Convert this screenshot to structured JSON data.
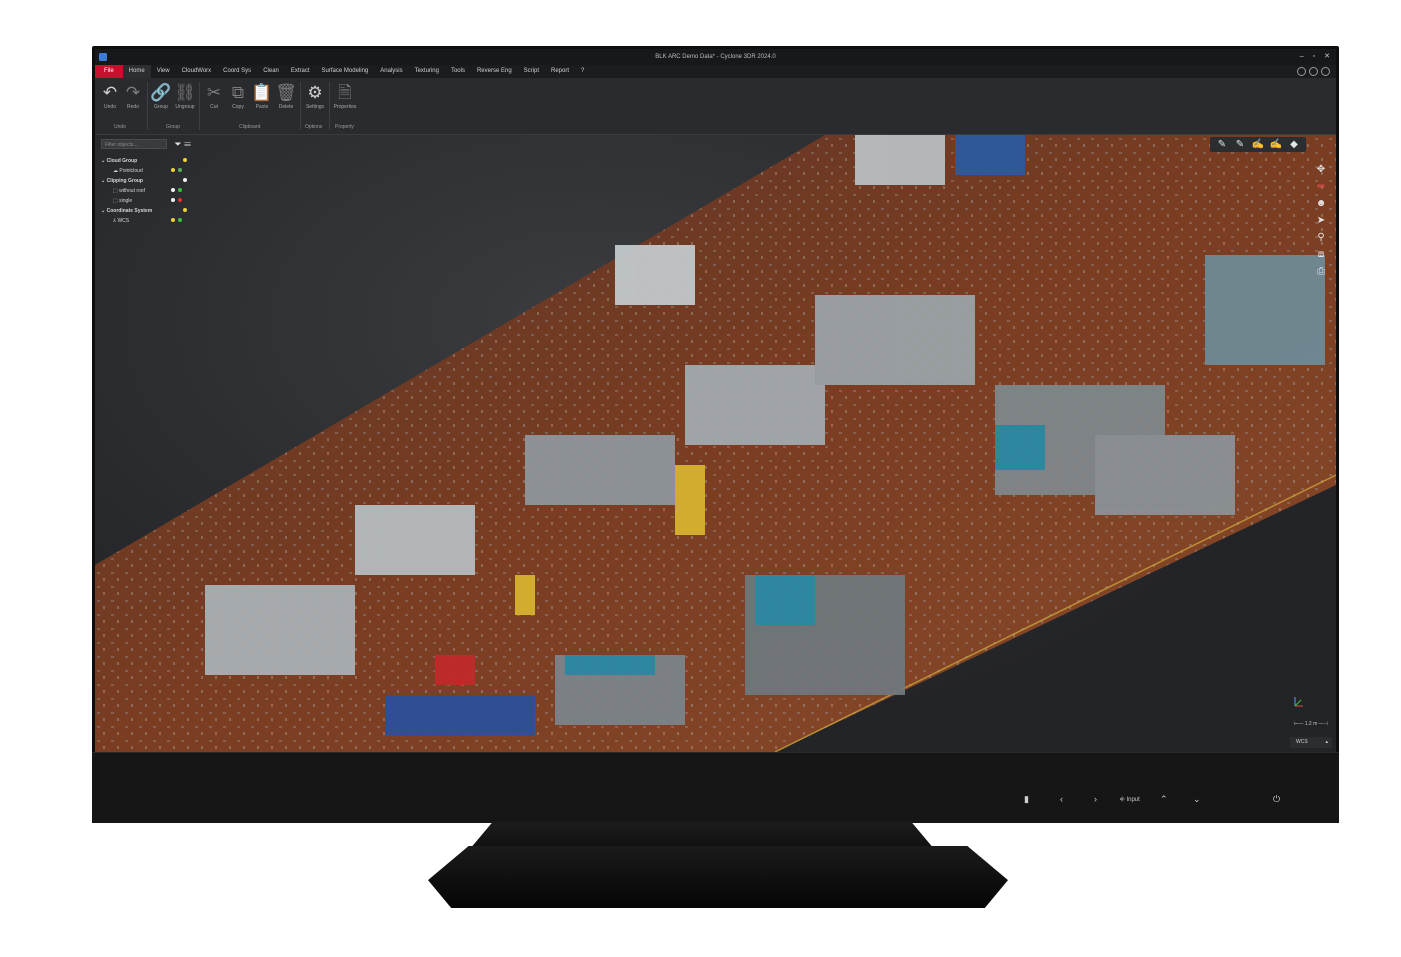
{
  "window": {
    "title": "BLK ARC Demo Data* - Cyclone 3DR 2024.0"
  },
  "menu": [
    "File",
    "Home",
    "View",
    "CloudWorx",
    "Coord Sys",
    "Clean",
    "Extract",
    "Surface Modeling",
    "Analysis",
    "Texturing",
    "Tools",
    "Reverse Eng",
    "Script",
    "Report",
    "?"
  ],
  "ribbon": {
    "buttons": [
      {
        "label": "Undo",
        "icon": "undo-icon",
        "glyph": "↶"
      },
      {
        "label": "Redo",
        "icon": "redo-icon",
        "glyph": "↷"
      },
      {
        "label": "Group",
        "icon": "link-icon",
        "glyph": "🔗"
      },
      {
        "label": "Ungroup",
        "icon": "unlink-icon",
        "glyph": "⛓"
      },
      {
        "label": "Cut",
        "icon": "scissors-icon",
        "glyph": "✂"
      },
      {
        "label": "Copy",
        "icon": "copy-icon",
        "glyph": "⧉"
      },
      {
        "label": "Paste",
        "icon": "paste-icon",
        "glyph": "📋"
      },
      {
        "label": "Delete",
        "icon": "trash-icon",
        "glyph": "🗑"
      },
      {
        "label": "Settings",
        "icon": "gears-icon",
        "glyph": "⚙"
      },
      {
        "label": "Properties",
        "icon": "document-icon",
        "glyph": "🗎"
      }
    ],
    "groups": [
      "Undo",
      "Group",
      "Clipboard",
      "Options",
      "Property"
    ]
  },
  "tree": {
    "filter_placeholder": "Filter objects...",
    "rows": [
      {
        "label": "Cloud Group",
        "bold": true
      },
      {
        "label": "Pointcloud",
        "bold": false
      },
      {
        "label": "Clipping Group",
        "bold": true
      },
      {
        "label": "without roof",
        "bold": false
      },
      {
        "label": "single",
        "bold": false
      },
      {
        "label": "Coordinate System",
        "bold": true
      },
      {
        "label": "WCS",
        "bold": false
      }
    ]
  },
  "viewport": {
    "scale_label": "1.2 m",
    "coord_system": "WCS"
  },
  "monitor": {
    "input_label": "Input"
  },
  "colors": {
    "accent": "#c8102e",
    "floor": "#7a3d22"
  }
}
